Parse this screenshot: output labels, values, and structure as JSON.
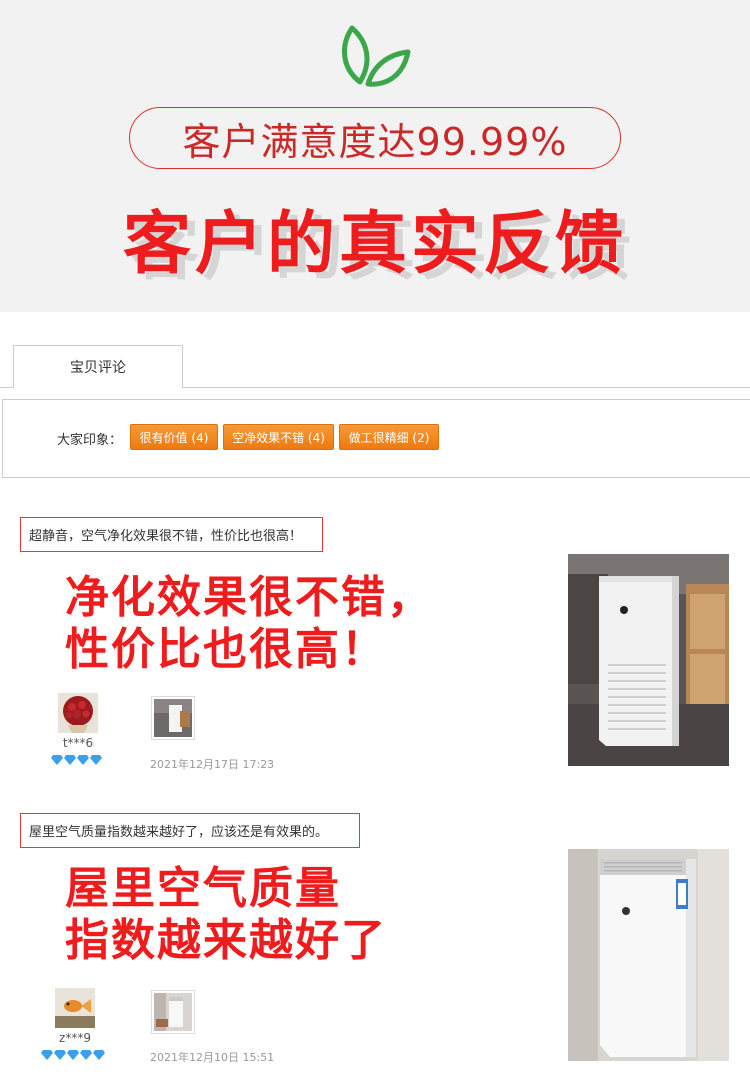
{
  "banner": {
    "satisfaction": "客户满意度达99.99%",
    "title": "客户的真实反馈",
    "accent_color": "#ee1c1c",
    "leaf_color": "#3aa84a"
  },
  "tabs": [
    {
      "label": "宝贝评论"
    }
  ],
  "impressions": {
    "label": "大家印象：",
    "tags": [
      "很有价值 (4)",
      "空净效果不错 (4)",
      "做工很精细 (2)"
    ],
    "tag_color": "#f08a20"
  },
  "reviews": [
    {
      "quote": "超静音，空气净化效果很不错，性价比也很高！",
      "highlight_lines": [
        "净化效果很不错，",
        "性价比也很高！"
      ],
      "user": "t***6",
      "diamonds": 4,
      "date": "2021年12月17日 17:23",
      "thumb_icon": "air-purifier-thumb",
      "photo": "air-purifier-photo"
    },
    {
      "quote": "屋里空气质量指数越来越好了，应该还是有效果的。",
      "highlight_lines": [
        "屋里空气质量",
        "指数越来越好了"
      ],
      "user": "z***9",
      "diamonds": 5,
      "date": "2021年12月10日 15:51",
      "thumb_icon": "air-purifier-thumb",
      "photo": "air-purifier-photo"
    }
  ]
}
